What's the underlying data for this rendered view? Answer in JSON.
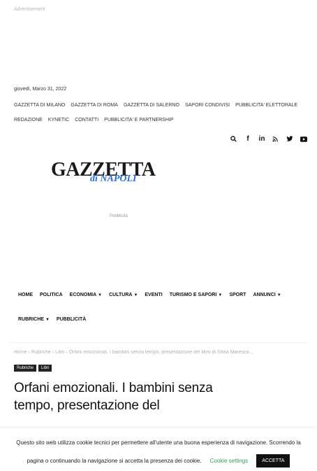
{
  "ad_label": "Advertisement",
  "date": "giovedì, Marzo 31, 2022",
  "top_links": [
    "GAZZETTA DI MILANO",
    "GAZZETTA DI ROMA",
    "GAZZETTA DI SALERNO",
    "SAPORI CONDIVISI",
    "PUBBLICITA' ELETTORALE",
    "REDAZIONE",
    "KYNETIC",
    "CONTATTI",
    "PUBBLICITA' E PARTNERSHIP"
  ],
  "social_icons": [
    "search-icon",
    "facebook-icon",
    "linkedin-icon",
    "rss-icon",
    "twitter-icon",
    "youtube-icon"
  ],
  "logo": {
    "main": "GAZZETTA",
    "sub": "di NAPOLI"
  },
  "pubblicita_label": "Pubblicità",
  "nav": [
    {
      "label": "HOME",
      "dropdown": false
    },
    {
      "label": "POLITICA",
      "dropdown": false
    },
    {
      "label": "ECONOMIA",
      "dropdown": true
    },
    {
      "label": "CULTURA",
      "dropdown": true
    },
    {
      "label": "EVENTI",
      "dropdown": false
    },
    {
      "label": "TURISMO E SAPORI",
      "dropdown": true
    },
    {
      "label": "SPORT",
      "dropdown": false
    },
    {
      "label": "ANNUNCI",
      "dropdown": true
    },
    {
      "label": "RUBRICHE",
      "dropdown": true
    },
    {
      "label": "PUBBLICITÀ",
      "dropdown": false
    }
  ],
  "breadcrumb": "Home › Rubriche › Libri › Orfani emozionali. I bambini senza tempo, presentazione del libro di Silvia Maresca...",
  "tags": [
    "Rubriche",
    "Libri"
  ],
  "article_title": "Orfani emozionali. I bambini senza tempo, presentazione del",
  "cookie": {
    "line1": "Questo sito web utilizza cookie tecnici per permettere all'utente una buona esperienza di navigazione. Scorrendo la",
    "line2": "pagina o continuando la navigazione si accetta la presenza dei cookie.",
    "settings_label": "Cookie settings",
    "accept_label": "ACCETTA"
  }
}
